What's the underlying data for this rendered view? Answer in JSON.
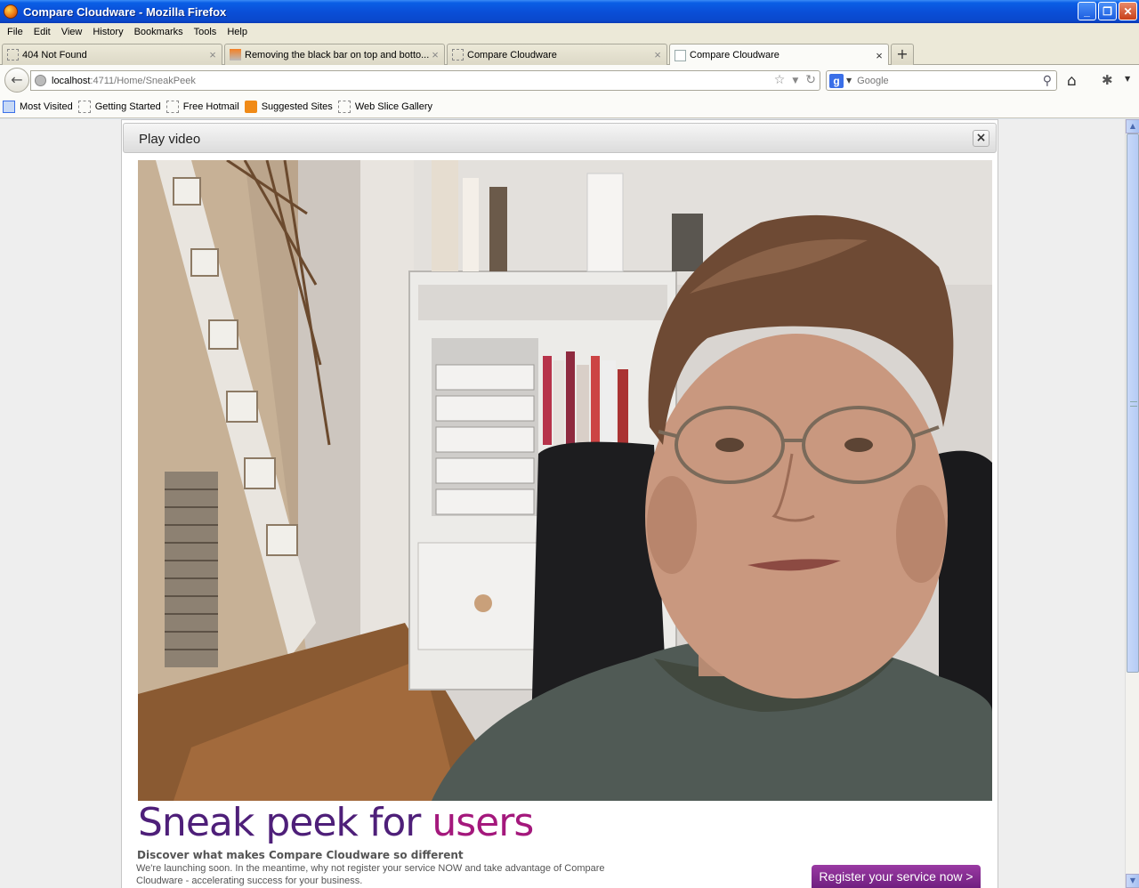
{
  "window": {
    "title": "Compare Cloudware - Mozilla Firefox"
  },
  "menu": [
    "File",
    "Edit",
    "View",
    "History",
    "Bookmarks",
    "Tools",
    "Help"
  ],
  "tabs": [
    {
      "label": "404 Not Found"
    },
    {
      "label": "Removing the black bar on top and botto..."
    },
    {
      "label": "Compare Cloudware"
    },
    {
      "label": "Compare Cloudware"
    }
  ],
  "nav": {
    "url_host": "localhost",
    "url_rest": ":4711/Home/SneakPeek",
    "search_placeholder": "Google",
    "search_engine_letter": "g"
  },
  "bookmarks": [
    "Most Visited",
    "Getting Started",
    "Free Hotmail",
    "Suggested Sites",
    "Web Slice Gallery"
  ],
  "dialog": {
    "title": "Play video",
    "close_glyph": "×",
    "headline_part1": "Sneak peek for ",
    "headline_part2": "users",
    "subheading": "Discover what makes Compare Cloudware so different",
    "blurb": "We're launching soon. In the meantime, why not register your service NOW and take advantage of Compare Cloudware - accelerating success for your business.",
    "register_button": "Register your service now >"
  },
  "colors": {
    "headline_purple": "#4e1f79",
    "headline_magenta": "#a4187c",
    "button": "#7f2a8c"
  }
}
